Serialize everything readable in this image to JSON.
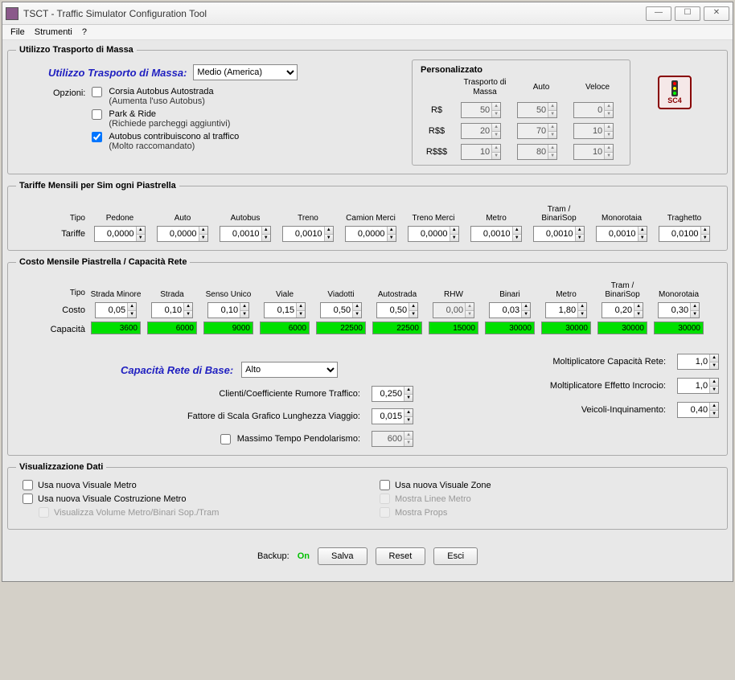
{
  "window": {
    "title": "TSCT - Traffic Simulator Configuration Tool"
  },
  "menu": {
    "file": "File",
    "tools": "Strumenti",
    "help": "?"
  },
  "mass": {
    "legend": "Utilizzo Trasporto di Massa",
    "title": "Utilizzo Trasporto di Massa:",
    "value": "Medio (America)",
    "options_label": "Opzioni:",
    "opt1": "Corsia Autobus Autostrada",
    "opt1b": "(Aumenta l'uso Autobus)",
    "opt2": "Park & Ride",
    "opt2b": "(Richiede parcheggi aggiuntivi)",
    "opt3": "Autobus contribuiscono al traffico",
    "opt3b": "(Molto raccomandato)",
    "custom_title": "Personalizzato",
    "col_mass": "Trasporto di Massa",
    "col_auto": "Auto",
    "col_speed": "Veloce",
    "row1": "R$",
    "row2": "R$$",
    "row3": "R$$$",
    "v": {
      "r1c1": "50",
      "r1c2": "50",
      "r1c3": "0",
      "r2c1": "20",
      "r2c2": "70",
      "r2c3": "10",
      "r3c1": "10",
      "r3c2": "80",
      "r3c3": "10"
    },
    "logo": "SC4"
  },
  "tariffe": {
    "legend": "Tariffe Mensili per Sim ogni Piastrella",
    "type": "Tipo",
    "label": "Tariffe",
    "cols": [
      "Pedone",
      "Auto",
      "Autobus",
      "Treno",
      "Camion Merci",
      "Treno Merci",
      "Metro",
      "Tram / BinariSop",
      "Monorotaia",
      "Traghetto"
    ],
    "vals": [
      "0,0000",
      "0,0000",
      "0,0010",
      "0,0010",
      "0,0000",
      "0,0000",
      "0,0010",
      "0,0010",
      "0,0010",
      "0,0100"
    ]
  },
  "cost": {
    "legend": "Costo Mensile Piastrella / Capacità Rete",
    "type": "Tipo",
    "costlbl": "Costo",
    "caplbl": "Capacità",
    "cols": [
      "Strada Minore",
      "Strada",
      "Senso Unico",
      "Viale",
      "Viadotti",
      "Autostrada",
      "RHW",
      "Binari",
      "Metro",
      "Tram / BinariSop",
      "Monorotaia"
    ],
    "costs": [
      "0,05",
      "0,10",
      "0,10",
      "0,15",
      "0,50",
      "0,50",
      "0,00",
      "0,03",
      "1,80",
      "0,20",
      "0,30"
    ],
    "caps": [
      "3600",
      "6000",
      "9000",
      "6000",
      "22500",
      "22500",
      "15000",
      "30000",
      "30000",
      "30000",
      "30000"
    ],
    "base_label": "Capacità Rete di Base:",
    "base_value": "Alto",
    "l1": "Clienti/Coefficiente Rumore Traffico:",
    "v1": "0,250",
    "l2": "Fattore di Scala Grafico Lunghezza Viaggio:",
    "v2": "0,015",
    "l3": "Massimo Tempo Pendolarismo:",
    "v3": "600",
    "r1": "Moltiplicatore Capacità Rete:",
    "rv1": "1,0",
    "r2": "Moltiplicatore Effetto Incrocio:",
    "rv2": "1,0",
    "r3": "Veicoli-Inquinamento:",
    "rv3": "0,40"
  },
  "vis": {
    "legend": "Visualizzazione Dati",
    "c1": "Usa nuova Visuale Metro",
    "c2": "Usa nuova Visuale Costruzione Metro",
    "c3": "Visualizza Volume Metro/Binari Sop./Tram",
    "c4": "Usa nuova Visuale Zone",
    "c5": "Mostra Linee Metro",
    "c6": "Mostra Props"
  },
  "footer": {
    "backup": "Backup:",
    "on": "On",
    "save": "Salva",
    "reset": "Reset",
    "exit": "Esci"
  }
}
